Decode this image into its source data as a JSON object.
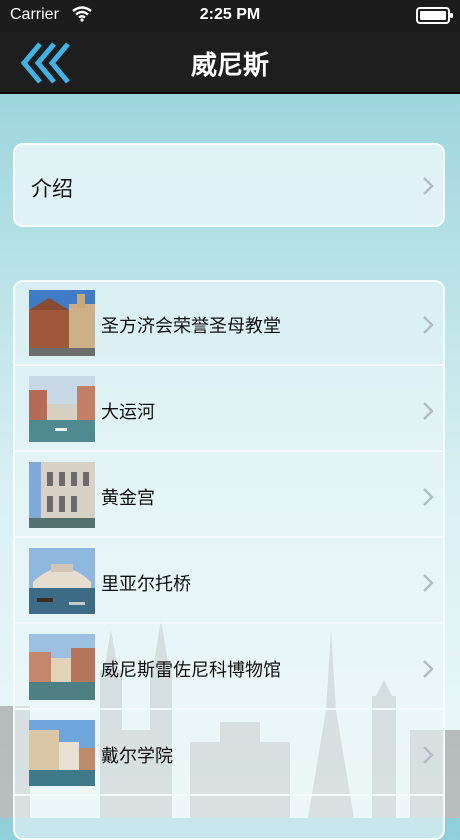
{
  "status_bar": {
    "carrier": "Carrier",
    "time": "2:25 PM"
  },
  "nav": {
    "title": "威尼斯"
  },
  "intro": {
    "label": "介绍"
  },
  "places": [
    {
      "name": "圣方济会荣誉圣母教堂"
    },
    {
      "name": "大运河"
    },
    {
      "name": "黄金宫"
    },
    {
      "name": "里亚尔托桥"
    },
    {
      "name": "威尼斯雷佐尼科博物馆"
    },
    {
      "name": "戴尔学院"
    }
  ],
  "colors": {
    "accent": "#3fb3e6",
    "nav_bg": "#1e1e1e",
    "bg_top": "#8fcfd9"
  },
  "icons": {
    "back": "triple-chevron-left-icon",
    "disclosure": "chevron-right-icon"
  }
}
